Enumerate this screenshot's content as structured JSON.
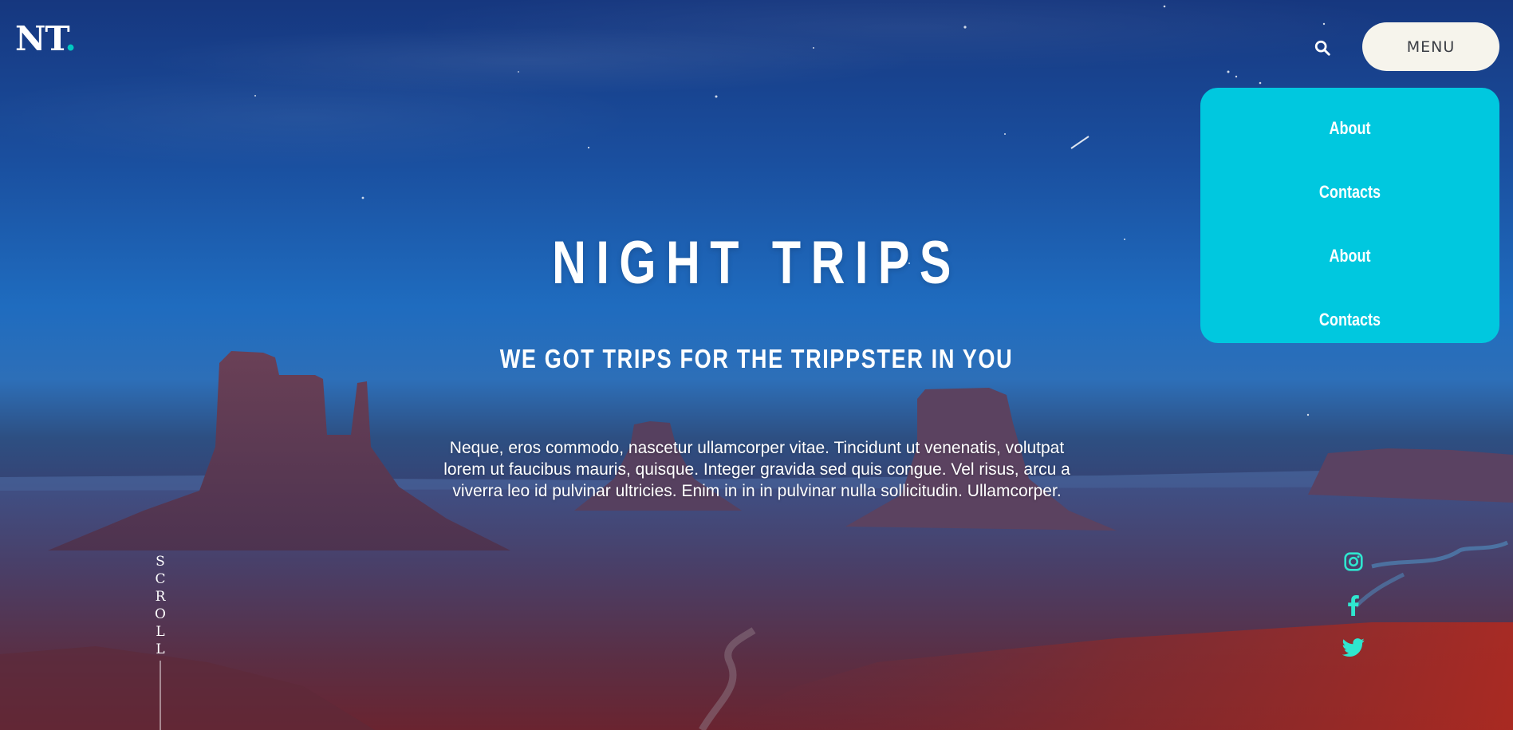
{
  "header": {
    "logo_text": "NT",
    "logo_dot": ".",
    "search_icon": "search-icon",
    "menu_label": "MENU"
  },
  "dropdown": {
    "items": [
      {
        "label": "About"
      },
      {
        "label": "Contacts"
      },
      {
        "label": "About"
      },
      {
        "label": "Contacts"
      }
    ]
  },
  "hero": {
    "title": "NIGHT TRIPS",
    "subtitle": "WE GOT TRIPS FOR THE TRIPPSTER IN YOU",
    "body": "Neque, eros commodo, nascetur ullamcorper vitae. Tincidunt ut venenatis, volutpat lorem ut faucibus mauris, quisque. Integer gravida sed quis congue. Vel risus, arcu a viverra leo id pulvinar ultricies. Enim in in in pulvinar nulla sollicitudin. Ullamcorper."
  },
  "scroll": {
    "letters": [
      "S",
      "C",
      "R",
      "O",
      "L",
      "L"
    ]
  },
  "social": {
    "icons": [
      "instagram-icon",
      "facebook-icon",
      "twitter-icon"
    ]
  },
  "colors": {
    "accent": "#00c9c1",
    "dropdown_bg": "#00c8df",
    "menu_button_bg": "#f6f4ec",
    "social_icon": "#2fe6cf"
  }
}
